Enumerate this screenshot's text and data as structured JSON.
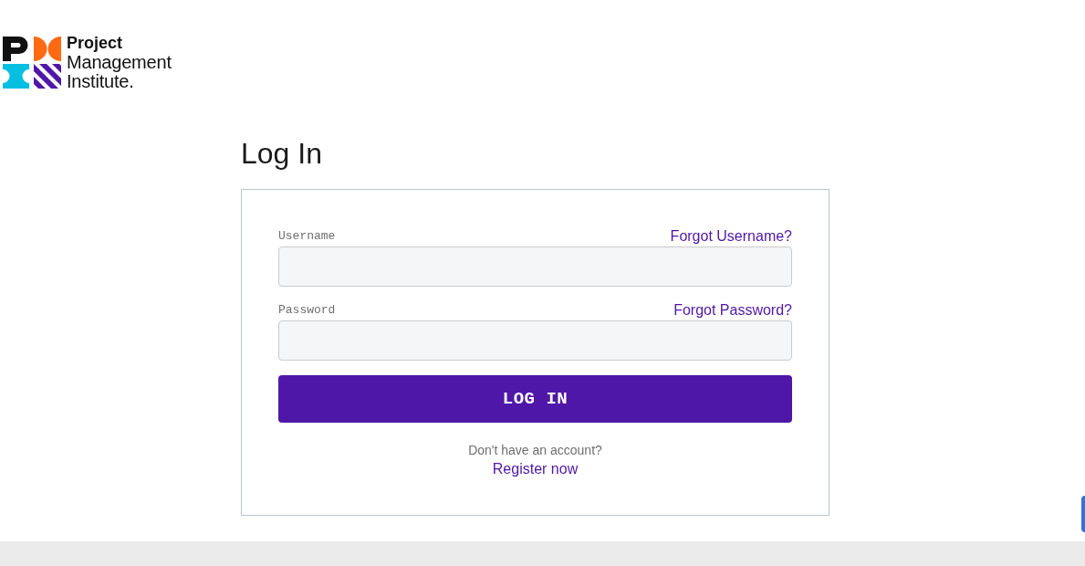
{
  "logo": {
    "lines": [
      "Project",
      "Management",
      "Institute."
    ]
  },
  "heading": "Log In",
  "form": {
    "fields": [
      {
        "label": "Username",
        "link": "Forgot Username?"
      },
      {
        "label": "Password",
        "link": "Forgot Password?"
      }
    ],
    "submit": "LOG IN",
    "signup_prompt": "Don't have an account?",
    "signup_link": "Register now"
  }
}
